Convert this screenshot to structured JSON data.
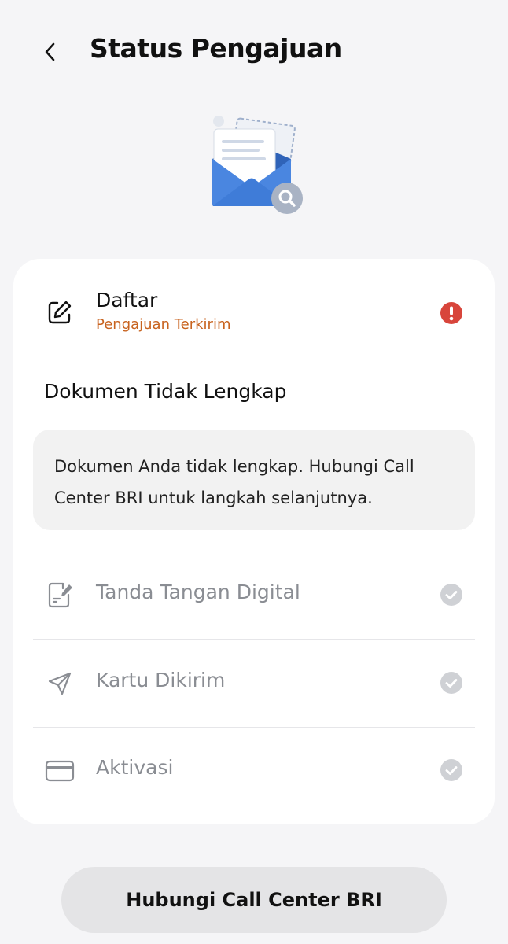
{
  "header": {
    "title": "Status Pengajuan"
  },
  "steps": {
    "daftar": {
      "title": "Daftar",
      "subtitle": "Pengajuan Terkirim",
      "status": "error"
    },
    "tanda_tangan": {
      "title": "Tanda Tangan Digital",
      "status": "pending"
    },
    "kartu": {
      "title": "Kartu Dikirim",
      "status": "pending"
    },
    "aktivasi": {
      "title": "Aktivasi",
      "status": "pending"
    }
  },
  "notice": {
    "heading": "Dokumen Tidak Lengkap",
    "message": "Dokumen Anda tidak lengkap. Hubungi Call Center BRI untuk langkah selanjutnya."
  },
  "actions": {
    "call_center_label": "Hubungi Call Center BRI"
  },
  "colors": {
    "error": "#d8453b",
    "subtitle_orange": "#c8631f",
    "muted": "#8a8d93",
    "envelope_blue": "#3f7cd8"
  }
}
